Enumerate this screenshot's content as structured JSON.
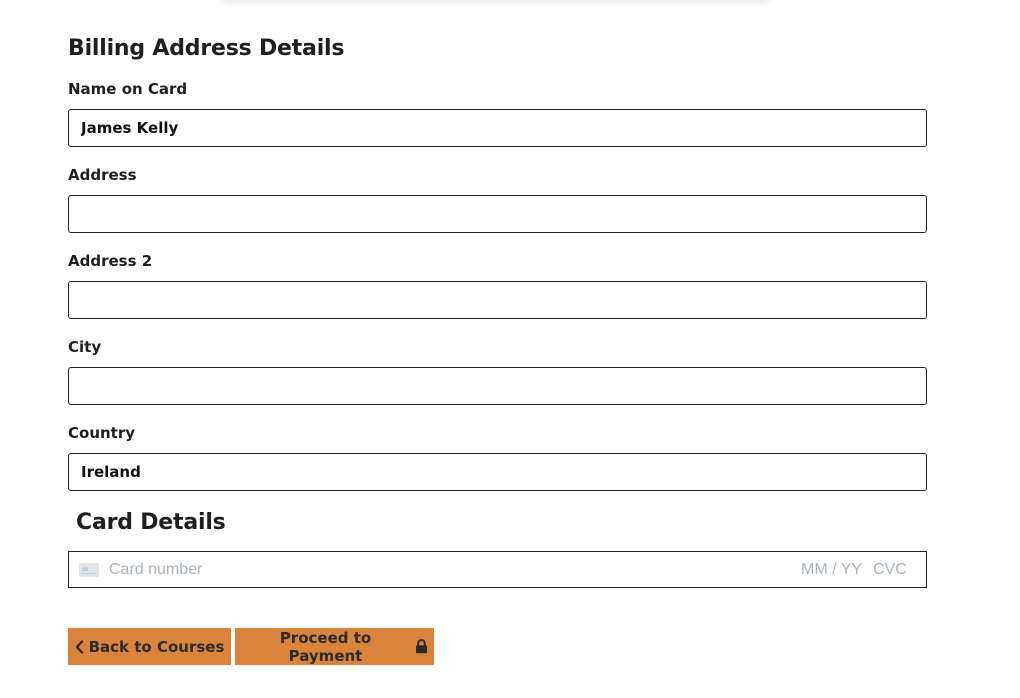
{
  "billing": {
    "title": "Billing Address Details",
    "fields": [
      {
        "label": "Name on Card",
        "value": ""
      },
      {
        "label": "Address",
        "value": ""
      },
      {
        "label": "Address 2",
        "value": ""
      },
      {
        "label": "City",
        "value": ""
      },
      {
        "label": "Country",
        "value": ""
      }
    ],
    "name_value": "James Kelly",
    "country_value": "Ireland"
  },
  "card": {
    "title": "Card Details",
    "number_placeholder": "Card number",
    "expiry_placeholder": "MM / YY",
    "cvc_placeholder": "CVC",
    "icon": "credit-card-icon"
  },
  "buttons": {
    "back_label": "Back to Courses",
    "back_icon": "chevron-left-icon",
    "proceed_label": "Proceed to Payment",
    "proceed_icon": "lock-icon",
    "accent_color": "#d9843a"
  }
}
